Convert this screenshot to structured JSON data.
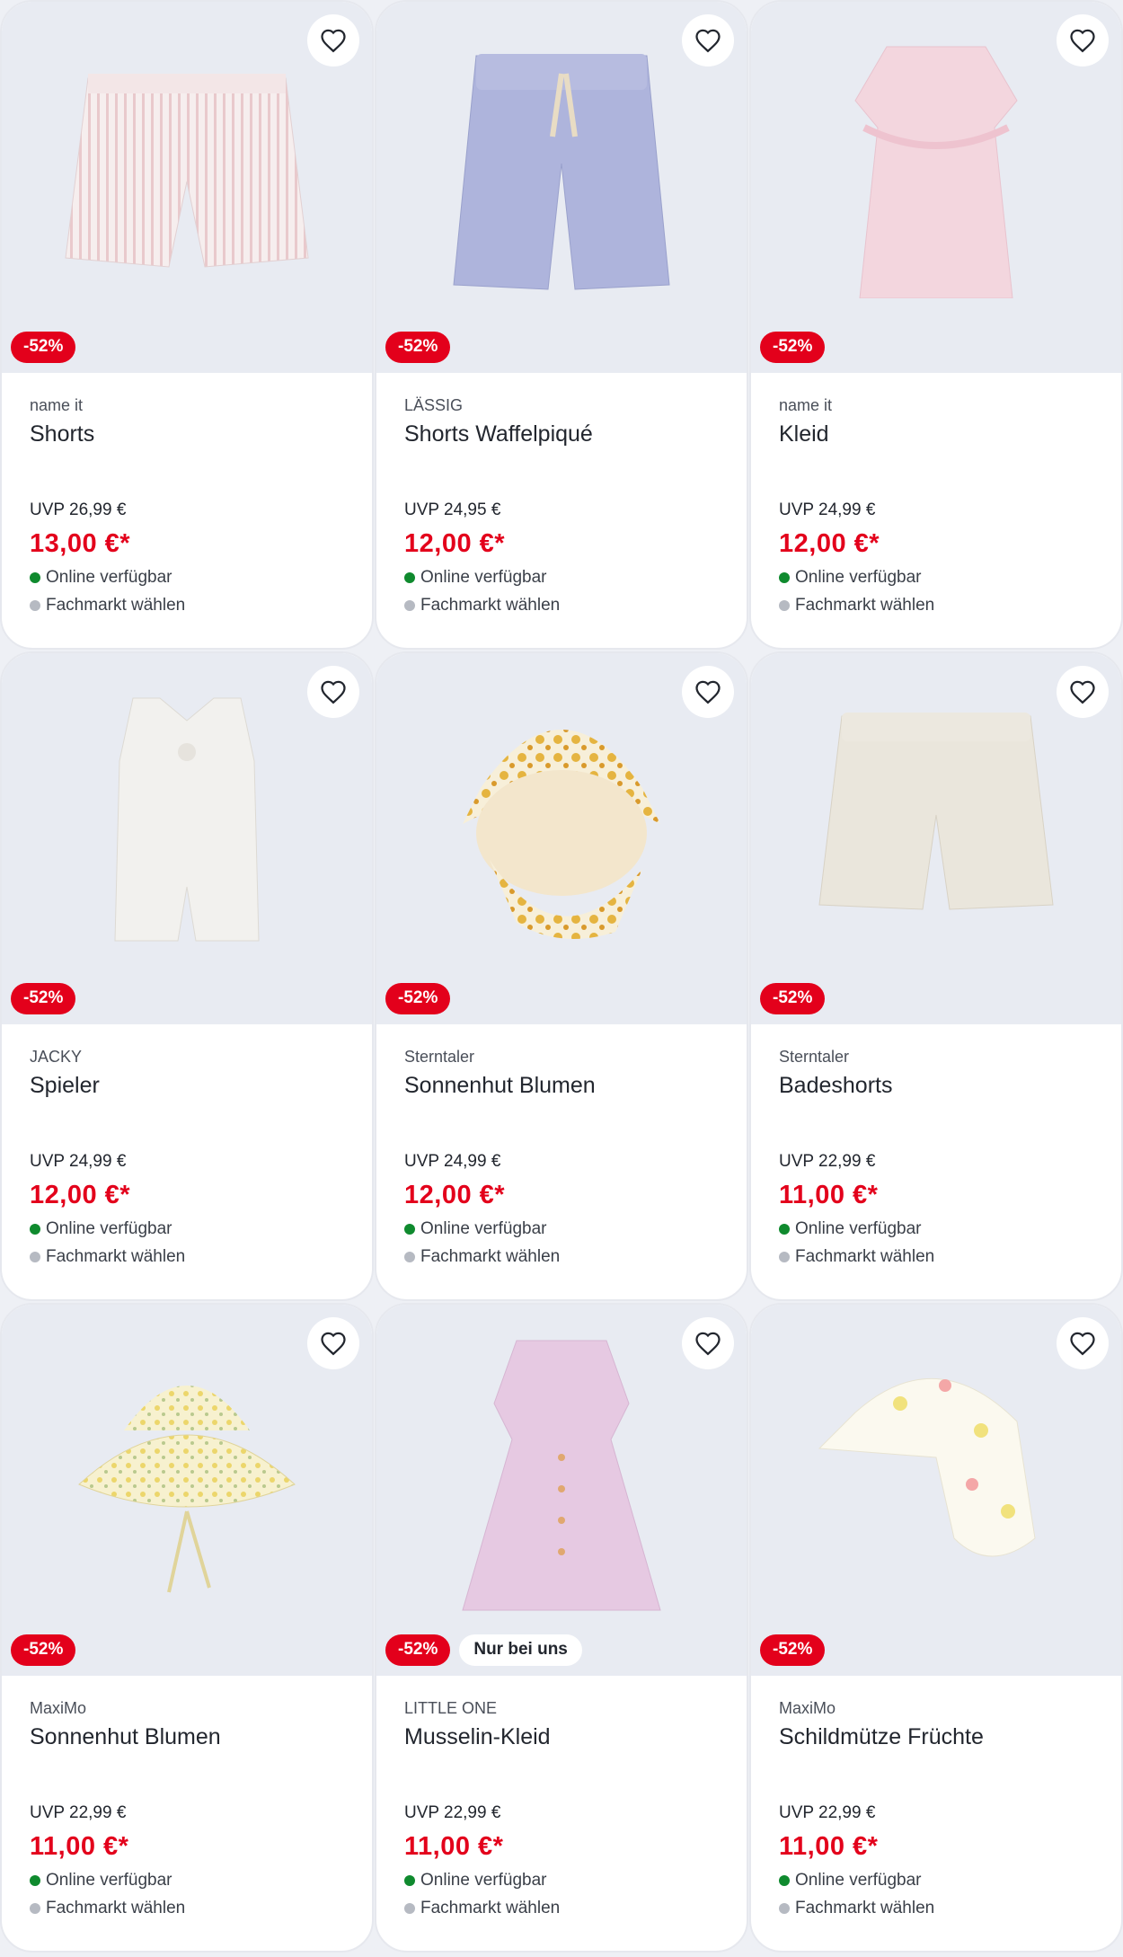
{
  "colors": {
    "accent": "#e3001b",
    "available": "#0f8a2e",
    "store": "#b6bac2"
  },
  "products": [
    {
      "brand": "name it",
      "title": "Shorts",
      "uvp": "UVP 26,99 €",
      "price": "13,00 €*",
      "discount": "-52%",
      "exclusive": "",
      "availability": "Online verfügbar",
      "store": "Fachmarkt wählen",
      "image": "striped-shorts"
    },
    {
      "brand": "LÄSSIG",
      "title": "Shorts Waffelpiqué",
      "uvp": "UVP 24,95 €",
      "price": "12,00 €*",
      "discount": "-52%",
      "exclusive": "",
      "availability": "Online verfügbar",
      "store": "Fachmarkt wählen",
      "image": "blue-shorts"
    },
    {
      "brand": "name it",
      "title": "Kleid",
      "uvp": "UVP 24,99 €",
      "price": "12,00 €*",
      "discount": "-52%",
      "exclusive": "",
      "availability": "Online verfügbar",
      "store": "Fachmarkt wählen",
      "image": "pink-dress"
    },
    {
      "brand": "JACKY",
      "title": "Spieler",
      "uvp": "UVP 24,99 €",
      "price": "12,00 €*",
      "discount": "-52%",
      "exclusive": "",
      "availability": "Online verfügbar",
      "store": "Fachmarkt wählen",
      "image": "white-romper"
    },
    {
      "brand": "Sterntaler",
      "title": "Sonnenhut Blumen",
      "uvp": "UVP 24,99 €",
      "price": "12,00 €*",
      "discount": "-52%",
      "exclusive": "",
      "availability": "Online verfügbar",
      "store": "Fachmarkt wählen",
      "image": "sun-hat-yellow"
    },
    {
      "brand": "Sterntaler",
      "title": "Badeshorts",
      "uvp": "UVP 22,99 €",
      "price": "11,00 €*",
      "discount": "-52%",
      "exclusive": "",
      "availability": "Online verfügbar",
      "store": "Fachmarkt wählen",
      "image": "beige-shorts"
    },
    {
      "brand": "MaxiMo",
      "title": "Sonnenhut Blumen",
      "uvp": "UVP 22,99 €",
      "price": "11,00 €*",
      "discount": "-52%",
      "exclusive": "",
      "availability": "Online verfügbar",
      "store": "Fachmarkt wählen",
      "image": "bucket-hat"
    },
    {
      "brand": "LITTLE ONE",
      "title": "Musselin-Kleid",
      "uvp": "UVP 22,99 €",
      "price": "11,00 €*",
      "discount": "-52%",
      "exclusive": "Nur bei uns",
      "availability": "Online verfügbar",
      "store": "Fachmarkt wählen",
      "image": "lilac-dress"
    },
    {
      "brand": "MaxiMo",
      "title": "Schildmütze Früchte",
      "uvp": "UVP 22,99 €",
      "price": "11,00 €*",
      "discount": "-52%",
      "exclusive": "",
      "availability": "Online verfügbar",
      "store": "Fachmarkt wählen",
      "image": "fruit-cap"
    }
  ]
}
